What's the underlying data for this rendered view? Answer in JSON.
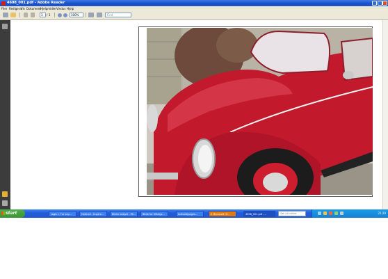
{
  "window": {
    "title": "4698_001.pdf - Adobe Reader"
  },
  "menu": [
    "Filer",
    "Redigera",
    "Vis",
    "Dokument",
    "Hjelpmidler",
    "Vindus",
    "Hjelp"
  ],
  "toolbar": {
    "page_current": "1",
    "page_separator": "/",
    "page_total": "1",
    "zoom": "100%",
    "find_placeholder": "Find"
  },
  "taskbar": {
    "start_label": "start",
    "items": [
      {
        "label": "Login » For seg..."
      },
      {
        "label": "Hotmail - Inspire..."
      },
      {
        "label": "Bilder widget - Mi..."
      },
      {
        "label": "Bilde for tilSalgs..."
      },
      {
        "label": "Indhold/pages..."
      },
      {
        "label": "2 Microsoft Of..."
      },
      {
        "label": "4698_001.pdf -..."
      }
    ],
    "search_placeholder": "Søk på nettet",
    "clock": "21:20"
  },
  "colors": {
    "car": "#c21a2c",
    "titlebar": "#1d55d0",
    "taskbar": "#245edb",
    "start": "#3a9632"
  },
  "icons": [
    "adobe-reader-icon",
    "print-icon",
    "email-icon",
    "prev-page-icon",
    "next-page-icon",
    "zoom-out-icon",
    "zoom-in-icon",
    "select-icon",
    "snapshot-icon",
    "pages-panel-icon",
    "comments-icon",
    "attachments-icon"
  ]
}
